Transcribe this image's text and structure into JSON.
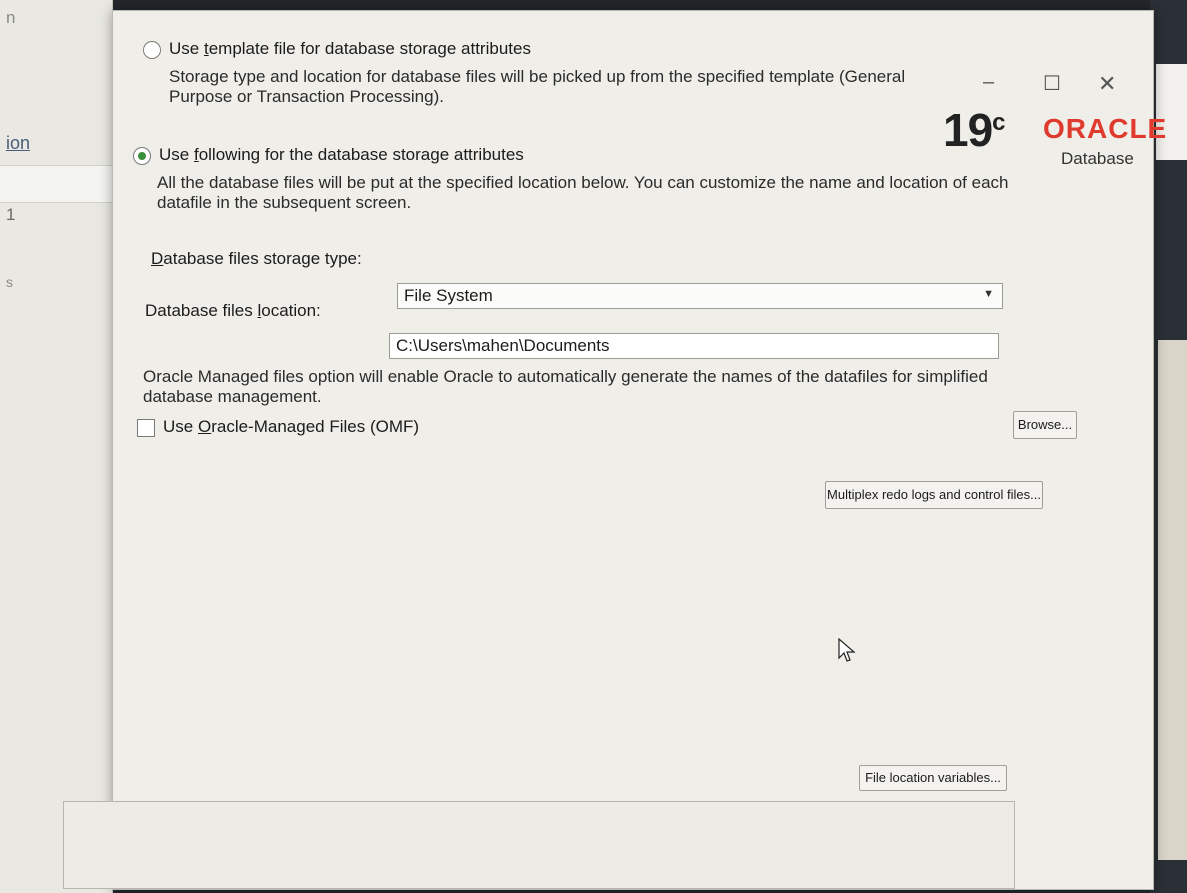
{
  "background": {
    "sidebar_items": [
      "n",
      "ion",
      "1",
      "s"
    ]
  },
  "window_controls": {
    "minimize": "–",
    "maximize": "☐",
    "close": "✕"
  },
  "logo": {
    "version": "19",
    "version_suffix": "c",
    "brand": "ORACLE",
    "product": "Database",
    "brand_color": "#e03a2e"
  },
  "options": {
    "template": {
      "label_pre": "Use ",
      "label_mnemonic": "t",
      "label_post": "emplate file for database storage attributes",
      "description": "Storage type and location for database files will be picked up from the specified template (General Purpose or Transaction Processing).",
      "selected": false
    },
    "following": {
      "label_pre": "Use ",
      "label_mnemonic": "f",
      "label_post": "ollowing for the database storage attributes",
      "description": "All the database files will be put at the specified location below. You can customize the name and location of each datafile in the subsequent screen.",
      "selected": true
    }
  },
  "storage_type": {
    "label_mnemonic": "D",
    "label_post": "atabase files storage type:",
    "value": "File System"
  },
  "files_location": {
    "label_pre": "Database files ",
    "label_mnemonic": "l",
    "label_post": "ocation:",
    "value": "C:\\Users\\mahen\\Documents"
  },
  "omf": {
    "description": "Oracle Managed files option will enable Oracle to automatically generate the names of the datafiles for simplified database management.",
    "label_pre": "Use ",
    "label_mnemonic": "O",
    "label_post": "racle-Managed Files (OMF)",
    "checked": false
  },
  "buttons": {
    "browse": "Browse...",
    "multiplex": "Multiplex redo logs and control files...",
    "file_location_variables": "File location variables..."
  }
}
